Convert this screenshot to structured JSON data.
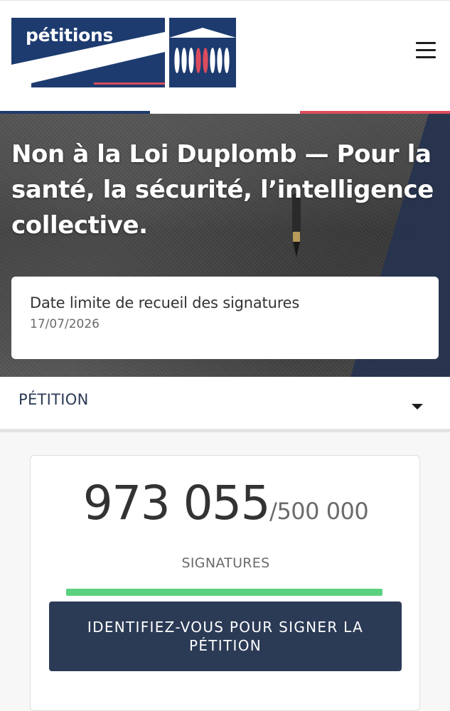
{
  "header": {
    "logo_text": "pétitions",
    "menu_icon": "hamburger-menu-icon"
  },
  "colors": {
    "navy": "#1d3b6f",
    "red": "#dc4c5c",
    "dark_button": "#2b3a55",
    "progress_green": "#5ad17f"
  },
  "hero": {
    "title": "Non à la Loi Duplomb — Pour la santé, la sécurité, l’intelligence collective.",
    "deadline_label": "Date limite de recueil des signatures",
    "deadline_date": "17/07/2026"
  },
  "section": {
    "label": "PÉTITION",
    "toggle_icon": "caret-down-icon"
  },
  "signatures": {
    "count": "973 055",
    "goal": "/500 000",
    "label": "SIGNATURES",
    "progress_fraction": 1.0,
    "sign_button_label": "IDENTIFIEZ-VOUS POUR SIGNER LA PÉTITION"
  }
}
